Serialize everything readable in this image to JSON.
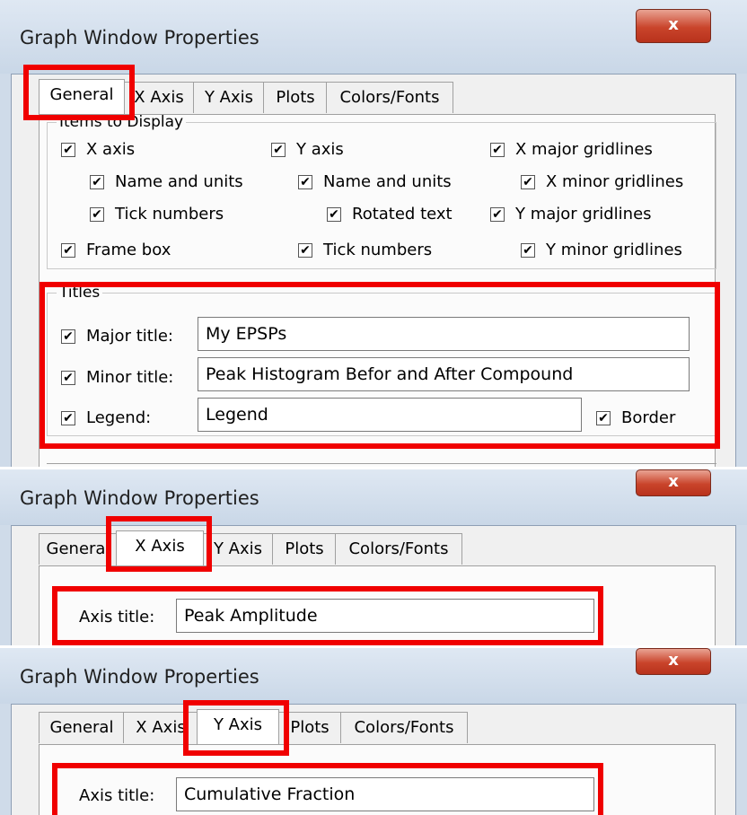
{
  "window_title": "Graph Window Properties",
  "close_glyph": "x",
  "check_glyph": "✔",
  "tabs": [
    "General",
    "X Axis",
    "Y Axis",
    "Plots",
    "Colors/Fonts"
  ],
  "general": {
    "items_group": "Items to Display",
    "x_axis": "X axis",
    "x_name_units": "Name and units",
    "x_tick_numbers": "Tick numbers",
    "frame_box": "Frame box",
    "y_axis": "Y axis",
    "y_name_units": "Name and units",
    "rotated_text": "Rotated text",
    "y_tick_numbers": "Tick numbers",
    "x_major": "X major gridlines",
    "x_minor": "X minor gridlines",
    "y_major": "Y major gridlines",
    "y_minor": "Y minor gridlines",
    "titles_group": "Titles",
    "major_title_label": "Major title:",
    "major_title_value": "My EPSPs",
    "minor_title_label": "Minor title:",
    "minor_title_value": "Peak Histogram Befor and After Compound",
    "legend_label": "Legend:",
    "legend_value": "Legend",
    "border_label": "Border"
  },
  "x_axis_tab": {
    "axis_title_label": "Axis title:",
    "axis_title_value": "Peak Amplitude"
  },
  "y_axis_tab": {
    "axis_title_label": "Axis title:",
    "axis_title_value": "Cumulative Fraction"
  }
}
